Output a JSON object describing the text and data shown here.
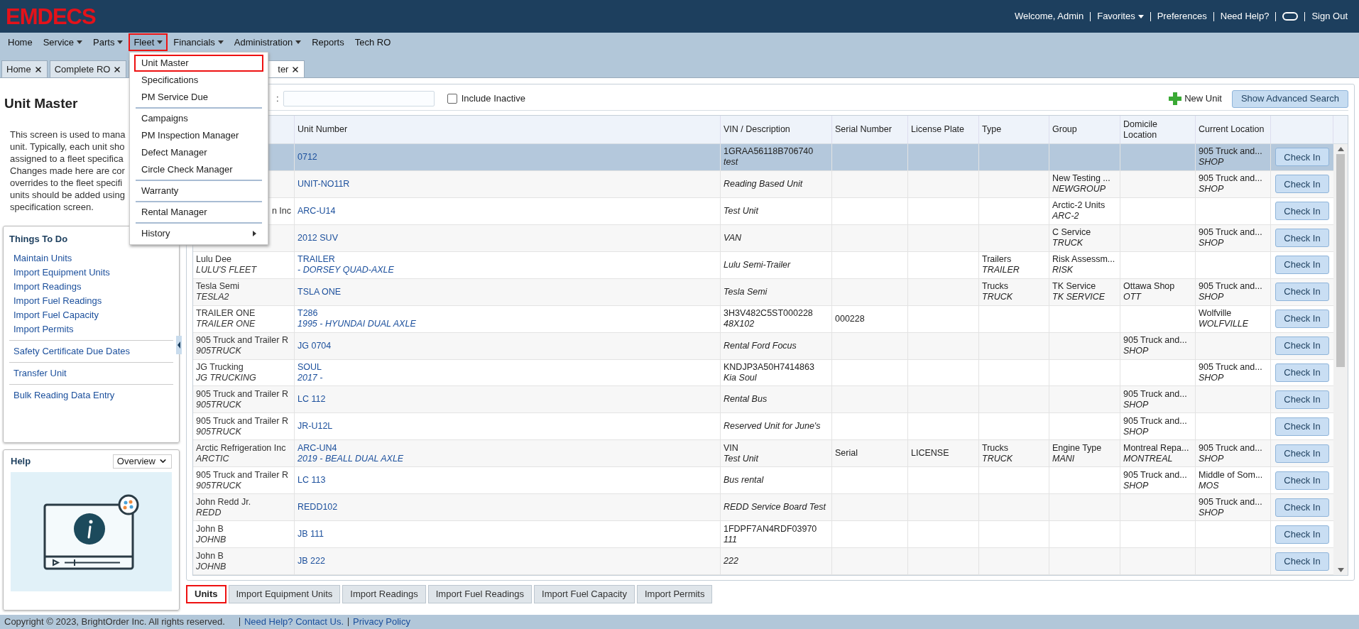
{
  "logo": "EMDECS",
  "header_links": [
    {
      "kind": "text",
      "label": "Welcome, Admin"
    },
    {
      "kind": "menu",
      "label": "Favorites"
    },
    {
      "kind": "link",
      "label": "Preferences"
    },
    {
      "kind": "link",
      "label": "Need Help?"
    },
    {
      "kind": "toggle"
    },
    {
      "kind": "link",
      "label": "Sign Out"
    }
  ],
  "nav": [
    {
      "label": "Home",
      "has_menu": false,
      "selected": false
    },
    {
      "label": "Service",
      "has_menu": true,
      "selected": false
    },
    {
      "label": "Parts",
      "has_menu": true,
      "selected": false
    },
    {
      "label": "Fleet",
      "has_menu": true,
      "selected": true
    },
    {
      "label": "Financials",
      "has_menu": true,
      "selected": false
    },
    {
      "label": "Administration",
      "has_menu": true,
      "selected": false
    },
    {
      "label": "Reports",
      "has_menu": false,
      "selected": false
    },
    {
      "label": "Tech RO",
      "has_menu": false,
      "selected": false
    }
  ],
  "fleet_menu": [
    {
      "kind": "item",
      "label": "Unit Master",
      "selected": true
    },
    {
      "kind": "item",
      "label": "Specifications",
      "selected": false
    },
    {
      "kind": "item",
      "label": "PM Service Due",
      "selected": false
    },
    {
      "kind": "separator"
    },
    {
      "kind": "item",
      "label": "Campaigns",
      "selected": false
    },
    {
      "kind": "item",
      "label": "PM Inspection Manager",
      "selected": false
    },
    {
      "kind": "item",
      "label": "Defect Manager",
      "selected": false
    },
    {
      "kind": "item",
      "label": "Circle Check Manager",
      "selected": false
    },
    {
      "kind": "separator"
    },
    {
      "kind": "item",
      "label": "Warranty",
      "selected": false
    },
    {
      "kind": "separator"
    },
    {
      "kind": "item",
      "label": "Rental Manager",
      "selected": false
    },
    {
      "kind": "separator"
    },
    {
      "kind": "submenu",
      "label": "History",
      "selected": false
    }
  ],
  "tabs": [
    {
      "label": "Home",
      "selected": false
    },
    {
      "label": "Complete RO",
      "selected": false
    },
    {
      "label": "ter",
      "selected": true
    }
  ],
  "sidebar": {
    "title": "Unit Master",
    "description": [
      "This screen is used to mana",
      "unit. Typically, each unit sho",
      "assigned to a fleet specifica",
      "Changes made here are cor",
      "overrides to the fleet specifi",
      "units should be added using",
      "specification screen."
    ],
    "todo_title": "Things To Do",
    "todo_groups": [
      [
        "Maintain Units",
        "Import Equipment Units",
        "Import Readings",
        "Import Fuel Readings",
        "Import Fuel Capacity",
        "Import Permits"
      ],
      [
        "Safety Certificate Due Dates"
      ],
      [
        "Transfer Unit"
      ],
      [
        "Bulk Reading Data Entry"
      ]
    ],
    "help_title": "Help",
    "help_select": "Overview"
  },
  "toolbar": {
    "search_label": ":",
    "include_inactive": {
      "label": "Include Inactive",
      "checked": false
    },
    "new_unit": "New Unit",
    "advanced": "Show Advanced Search"
  },
  "columns": [
    "Unit Number",
    "VIN / Description",
    "Serial Number",
    "License Plate",
    "Type",
    "Group",
    "Domicile Location",
    "Current Location"
  ],
  "rows": [
    {
      "selected": true,
      "unit": "0712",
      "vin": "1GRAA56118B706740",
      "description": "test",
      "current": {
        "name": "905 Truck and...",
        "code": "SHOP"
      },
      "action": "Check In"
    },
    {
      "selected": false,
      "unit": "UNIT-NO11R",
      "description": "Reading Based Unit",
      "group": {
        "name": "New Testing ...",
        "code": "NEWGROUP"
      },
      "current": {
        "name": "905 Truck and...",
        "code": "SHOP"
      },
      "action": "Check In"
    },
    {
      "selected": false,
      "owner": {
        "name": "n Inc",
        "cut": true
      },
      "unit": "ARC-U14",
      "description": "Test Unit",
      "group": {
        "name": "Arctic-2 Units",
        "code": "ARC-2"
      },
      "action": "Check In"
    },
    {
      "selected": false,
      "unit": "2012 SUV",
      "description": "VAN",
      "group": {
        "name": "C Service",
        "code": "TRUCK"
      },
      "current": {
        "name": "905 Truck and...",
        "code": "SHOP"
      },
      "action": "Check In"
    },
    {
      "selected": false,
      "owner": {
        "name": "Lulu Dee",
        "code": "LULU'S FLEET",
        "cut": false
      },
      "unit": "TRAILER",
      "unit_desc": "- DORSEY QUAD-AXLE",
      "description": "Lulu Semi-Trailer",
      "type": {
        "name": "Trailers",
        "code": "TRAILER"
      },
      "group": {
        "name": "Risk Assessm...",
        "code": "RISK"
      },
      "action": "Check In"
    },
    {
      "selected": false,
      "owner": {
        "name": "Tesla Semi",
        "code": "TESLA2",
        "cut": false
      },
      "unit": "TSLA ONE",
      "description": "Tesla Semi",
      "type": {
        "name": "Trucks",
        "code": "TRUCK"
      },
      "group": {
        "name": "TK Service",
        "code": "TK SERVICE"
      },
      "domicile": {
        "name": "Ottawa Shop",
        "code": "OTT"
      },
      "current": {
        "name": "905 Truck and...",
        "code": "SHOP"
      },
      "action": "Check In"
    },
    {
      "selected": false,
      "owner": {
        "name": "TRAILER ONE",
        "code": "TRAILER ONE",
        "cut": false
      },
      "unit": "T286",
      "unit_desc": "1995 - HYUNDAI DUAL AXLE",
      "vin": "3H3V482C5ST000228",
      "description": "48X102",
      "serial": "000228",
      "current": {
        "name": "Wolfville",
        "code": "WOLFVILLE"
      },
      "action": "Check In"
    },
    {
      "selected": false,
      "owner": {
        "name": "905 Truck and Trailer R",
        "code": "905TRUCK",
        "cut": false
      },
      "unit": "JG 0704",
      "description": "Rental Ford Focus",
      "domicile": {
        "name": "905 Truck and...",
        "code": "SHOP"
      },
      "action": "Check In"
    },
    {
      "selected": false,
      "owner": {
        "name": "JG Trucking",
        "code": "JG TRUCKING",
        "cut": false
      },
      "unit": "SOUL",
      "unit_desc": "2017 -",
      "vin": "KNDJP3A50H7414863",
      "description": "Kia Soul",
      "current": {
        "name": "905 Truck and...",
        "code": "SHOP"
      },
      "action": "Check In"
    },
    {
      "selected": false,
      "owner": {
        "name": "905 Truck and Trailer R",
        "code": "905TRUCK",
        "cut": false
      },
      "unit": "LC 112",
      "description": "Rental Bus",
      "domicile": {
        "name": "905 Truck and...",
        "code": "SHOP"
      },
      "action": "Check In"
    },
    {
      "selected": false,
      "owner": {
        "name": "905 Truck and Trailer R",
        "code": "905TRUCK",
        "cut": false
      },
      "unit": "JR-U12L",
      "description": "Reserved Unit for June's",
      "domicile": {
        "name": "905 Truck and...",
        "code": "SHOP"
      },
      "action": "Check In"
    },
    {
      "selected": false,
      "owner": {
        "name": "Arctic Refrigeration Inc",
        "code": "ARCTIC",
        "cut": false
      },
      "unit": "ARC-UN4",
      "unit_desc": "2019 - BEALL DUAL AXLE",
      "vin": "VIN",
      "description": "Test Unit",
      "serial": "Serial",
      "license": "LICENSE",
      "type": {
        "name": "Trucks",
        "code": "TRUCK"
      },
      "group": {
        "name": "Engine Type",
        "code": "MANI"
      },
      "domicile": {
        "name": "Montreal Repa...",
        "code": "MONTREAL"
      },
      "current": {
        "name": "905 Truck and...",
        "code": "SHOP"
      },
      "action": "Check In"
    },
    {
      "selected": false,
      "owner": {
        "name": "905 Truck and Trailer R",
        "code": "905TRUCK",
        "cut": false
      },
      "unit": "LC 113",
      "description": "Bus rental",
      "domicile": {
        "name": "905 Truck and...",
        "code": "SHOP"
      },
      "current": {
        "name": "Middle of Som...",
        "code": "MOS"
      },
      "action": "Check In"
    },
    {
      "selected": false,
      "owner": {
        "name": "John Redd Jr.",
        "code": "REDD",
        "cut": false
      },
      "unit": "REDD102",
      "description": "REDD Service Board Test",
      "current": {
        "name": "905 Truck and...",
        "code": "SHOP"
      },
      "action": "Check In"
    },
    {
      "selected": false,
      "owner": {
        "name": "John B",
        "code": "JOHNB",
        "cut": false
      },
      "unit": "JB 111",
      "vin": "1FDPF7AN4RDF03970",
      "description": "111",
      "action": "Check In"
    },
    {
      "selected": false,
      "owner": {
        "name": "John B",
        "code": "JOHNB",
        "cut": false
      },
      "unit": "JB 222",
      "description": "222",
      "action": "Check In"
    }
  ],
  "bottom_tabs": [
    {
      "label": "Units",
      "selected": true
    },
    {
      "label": "Import Equipment Units",
      "selected": false
    },
    {
      "label": "Import Readings",
      "selected": false
    },
    {
      "label": "Import Fuel Readings",
      "selected": false
    },
    {
      "label": "Import Fuel Capacity",
      "selected": false
    },
    {
      "label": "Import Permits",
      "selected": false
    }
  ],
  "footer": {
    "copyright": "Copyright © 2023, BrightOrder Inc. All rights reserved.",
    "links": [
      "Need Help? Contact Us.",
      "Privacy Policy"
    ]
  }
}
